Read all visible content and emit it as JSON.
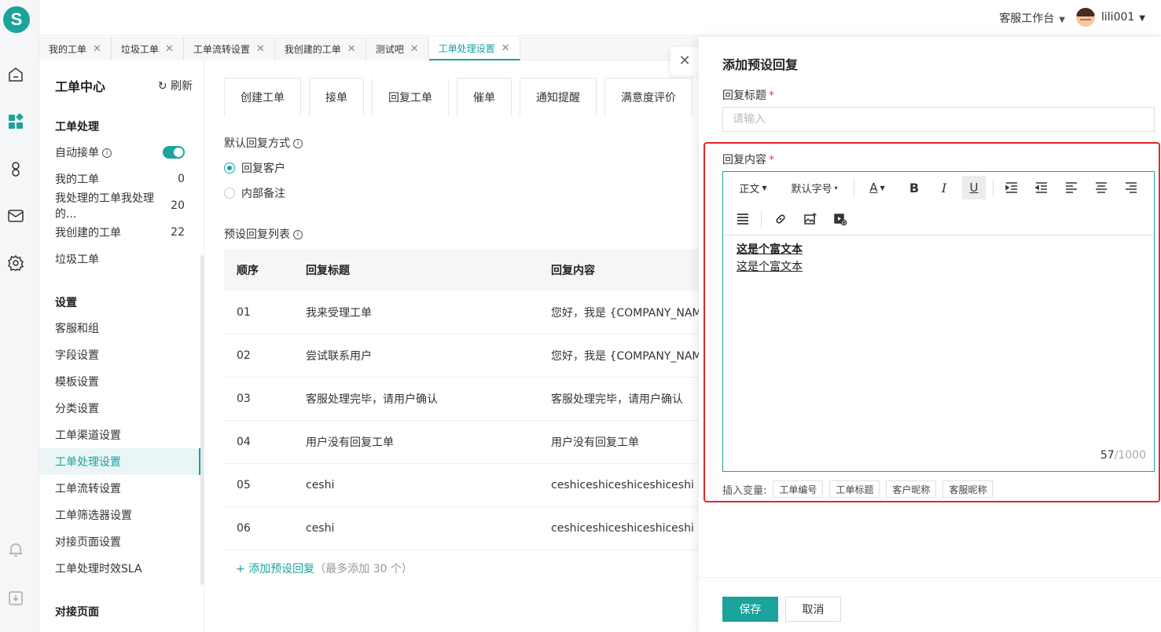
{
  "header": {
    "workspace": "客服工作台",
    "username": "lili001"
  },
  "logo": "S",
  "tabs": [
    {
      "label": "我的工单"
    },
    {
      "label": "垃圾工单"
    },
    {
      "label": "工单流转设置"
    },
    {
      "label": "我创建的工单"
    },
    {
      "label": "测试吧"
    },
    {
      "label": "工单处理设置"
    }
  ],
  "sidebar": {
    "title": "工单中心",
    "refresh": "刷新",
    "sec_process": "工单处理",
    "auto_accept": "自动接单",
    "my_tickets": {
      "label": "我的工单",
      "count": "0"
    },
    "handled": {
      "label": "我处理的工单我处理的...",
      "count": "20"
    },
    "created": {
      "label": "我创建的工单",
      "count": "22"
    },
    "trash": "垃圾工单",
    "sec_settings": "设置",
    "settings": [
      "客服和组",
      "字段设置",
      "模板设置",
      "分类设置",
      "工单渠道设置",
      "工单处理设置",
      "工单流转设置",
      "工单筛选器设置",
      "对接页面设置",
      "工单处理时效SLA"
    ],
    "sec_dock": "对接页面"
  },
  "main": {
    "subtabs": [
      "创建工单",
      "接单",
      "回复工单",
      "催单",
      "通知提醒",
      "满意度评价"
    ],
    "default_reply_label": "默认回复方式",
    "radio_customer": "回复客户",
    "radio_internal": "内部备注",
    "list_label": "预设回复列表",
    "table": {
      "headers": [
        "顺序",
        "回复标题",
        "回复内容"
      ],
      "rows": [
        [
          "01",
          "我来受理工单",
          "您好，我是 {COMPANY_NAME}"
        ],
        [
          "02",
          "尝试联系用户",
          "您好，我是 {COMPANY_NAME}"
        ],
        [
          "03",
          "客服处理完毕，请用户确认",
          "客服处理完毕，请用户确认"
        ],
        [
          "04",
          "用户没有回复工单",
          "用户没有回复工单"
        ],
        [
          "05",
          "ceshi",
          "ceshiceshiceshiceshiceshi"
        ],
        [
          "06",
          "ceshi",
          "ceshiceshiceshiceshiceshi"
        ]
      ]
    },
    "add_link": "添加预设回复",
    "add_hint": "（最多添加 30 个）"
  },
  "drawer": {
    "title": "添加预设回复",
    "title_label": "回复标题",
    "title_placeholder": "请输入",
    "content_label": "回复内容",
    "toolbar": {
      "para": "正文",
      "fontsize": "默认字号"
    },
    "content_line1": "这是个富文本",
    "content_line2": "这是个富文本",
    "counter_value": "57",
    "counter_max": "/1000",
    "vars_label": "插入变量:",
    "vars": [
      "工单编号",
      "工单标题",
      "客户昵称",
      "客服昵称"
    ],
    "save": "保存",
    "cancel": "取消"
  },
  "colors": {
    "accent": "#1ba39c",
    "highlight_box": "#e5252a"
  }
}
